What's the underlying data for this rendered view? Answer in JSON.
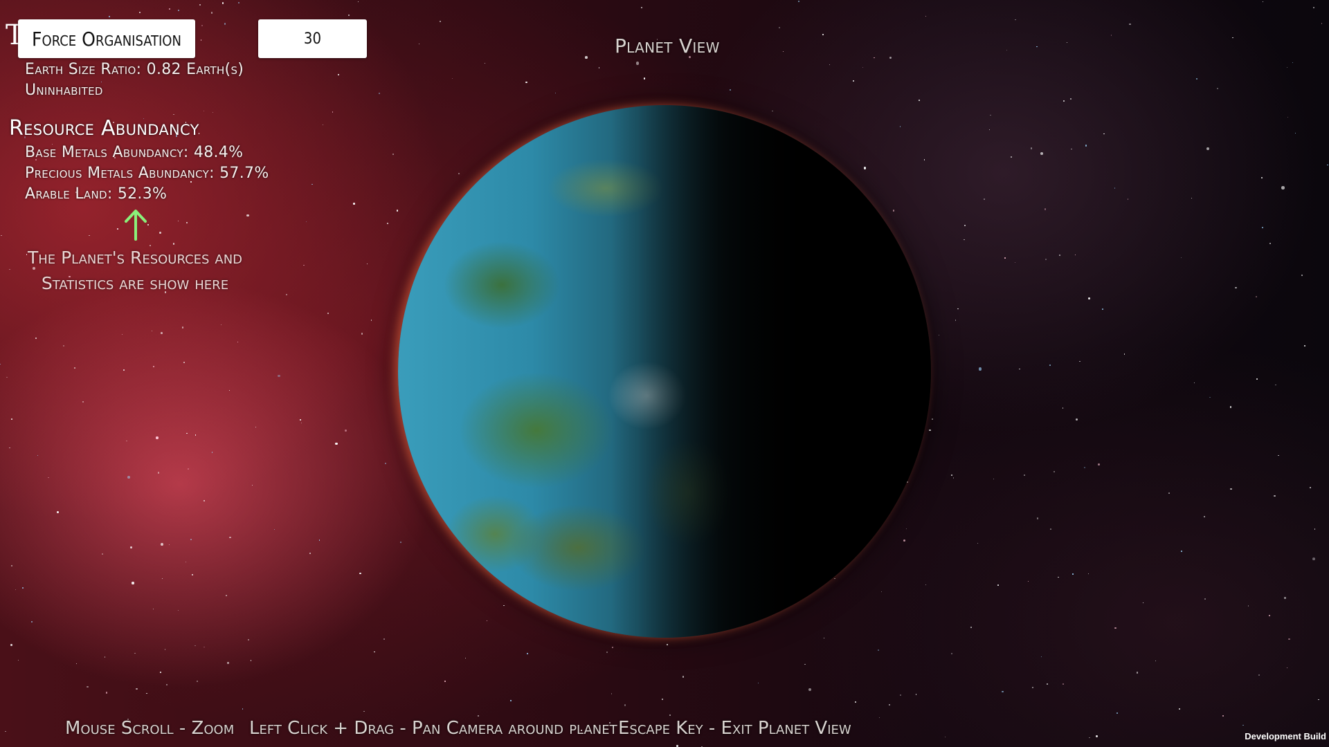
{
  "hud": {
    "title_fragment": "T",
    "force_button_label": "Force Organisation",
    "force_value": "30",
    "view_title": "Planet View"
  },
  "planet_stats": {
    "earth_size": "Earth Size Ratio: 0.82 Earth(s)",
    "population_status": "Uninhabited"
  },
  "resources": {
    "section_title": "Resource Abundancy",
    "items": [
      "Base Metals Abundancy: 48.4%",
      "Precious Metals Abundancy: 57.7%",
      "Arable Land: 52.3%"
    ]
  },
  "tutorial_hint": {
    "line1": "The Planet's Resources and",
    "line2": "Statistics are show here",
    "arrow_color": "#8af07a"
  },
  "controls": {
    "zoom": "Mouse Scroll - Zoom",
    "pan": "Left Click + Drag - Pan Camera around planet",
    "exit": "Escape Key - Exit Planet View"
  },
  "footer": {
    "build_label": "Development Build"
  }
}
